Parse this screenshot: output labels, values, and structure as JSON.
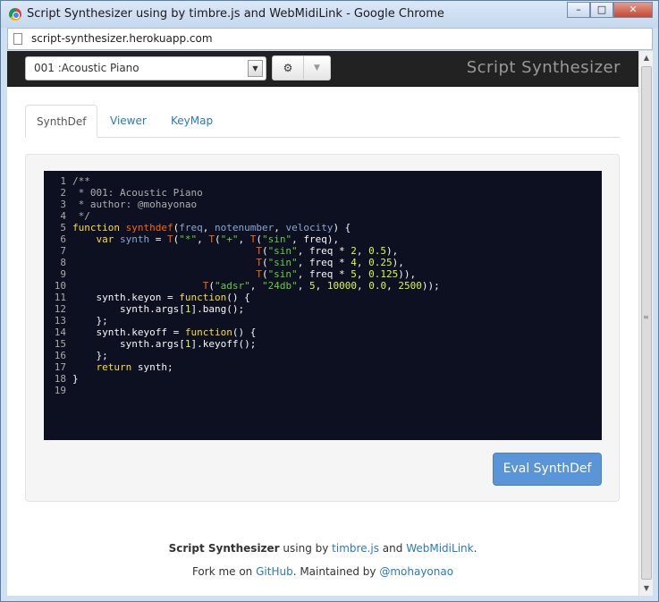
{
  "window": {
    "title": "Script Synthesizer using by timbre.js and WebMidiLink - Google Chrome",
    "url": "script-synthesizer.herokuapp.com"
  },
  "navbar": {
    "preset_value": "001 :Acoustic Piano",
    "brand": "Script Synthesizer"
  },
  "tabs": [
    "SynthDef",
    "Viewer",
    "KeyMap"
  ],
  "editor": {
    "line_numbers": [
      "1",
      "2",
      "3",
      "4",
      "5",
      "6",
      "7",
      "8",
      "9",
      "10",
      "11",
      "12",
      "13",
      "14",
      "15",
      "16",
      "17",
      "18",
      "19"
    ],
    "lines": [
      [
        [
          "cm",
          "/**"
        ]
      ],
      [
        [
          "cm",
          " * 001: Acoustic Piano"
        ]
      ],
      [
        [
          "cm",
          " * author: @mohayonao"
        ]
      ],
      [
        [
          "cm",
          " */"
        ]
      ],
      [
        [
          "kw",
          "function "
        ],
        [
          "fn",
          "synthdef"
        ],
        [
          "pl",
          "("
        ],
        [
          "var",
          "freq"
        ],
        [
          "pl",
          ", "
        ],
        [
          "var",
          "notenumber"
        ],
        [
          "pl",
          ", "
        ],
        [
          "var",
          "velocity"
        ],
        [
          "pl",
          ") {"
        ]
      ],
      [
        [
          "pl",
          "    "
        ],
        [
          "kw",
          "var "
        ],
        [
          "var",
          "synth"
        ],
        [
          "pl",
          " = "
        ],
        [
          "fn",
          "T"
        ],
        [
          "pl",
          "("
        ],
        [
          "str",
          "\"*\""
        ],
        [
          "pl",
          ", "
        ],
        [
          "fn",
          "T"
        ],
        [
          "pl",
          "("
        ],
        [
          "str",
          "\"+\""
        ],
        [
          "pl",
          ", "
        ],
        [
          "fn",
          "T"
        ],
        [
          "pl",
          "("
        ],
        [
          "str",
          "\"sin\""
        ],
        [
          "pl",
          ", freq),"
        ]
      ],
      [
        [
          "pl",
          "                               "
        ],
        [
          "fn",
          "T"
        ],
        [
          "pl",
          "("
        ],
        [
          "str",
          "\"sin\""
        ],
        [
          "pl",
          ", freq * "
        ],
        [
          "num",
          "2"
        ],
        [
          "pl",
          ", "
        ],
        [
          "num",
          "0.5"
        ],
        [
          "pl",
          "),"
        ]
      ],
      [
        [
          "pl",
          "                               "
        ],
        [
          "fn",
          "T"
        ],
        [
          "pl",
          "("
        ],
        [
          "str",
          "\"sin\""
        ],
        [
          "pl",
          ", freq * "
        ],
        [
          "num",
          "4"
        ],
        [
          "pl",
          ", "
        ],
        [
          "num",
          "0.25"
        ],
        [
          "pl",
          "),"
        ]
      ],
      [
        [
          "pl",
          "                               "
        ],
        [
          "fn",
          "T"
        ],
        [
          "pl",
          "("
        ],
        [
          "str",
          "\"sin\""
        ],
        [
          "pl",
          ", freq * "
        ],
        [
          "num",
          "5"
        ],
        [
          "pl",
          ", "
        ],
        [
          "num",
          "0.125"
        ],
        [
          "pl",
          ")),"
        ]
      ],
      [
        [
          "pl",
          "                      "
        ],
        [
          "fn",
          "T"
        ],
        [
          "pl",
          "("
        ],
        [
          "str",
          "\"adsr\""
        ],
        [
          "pl",
          ", "
        ],
        [
          "str",
          "\"24db\""
        ],
        [
          "pl",
          ", "
        ],
        [
          "num",
          "5"
        ],
        [
          "pl",
          ", "
        ],
        [
          "num",
          "10000"
        ],
        [
          "pl",
          ", "
        ],
        [
          "num",
          "0.0"
        ],
        [
          "pl",
          ", "
        ],
        [
          "num",
          "2500"
        ],
        [
          "pl",
          "));"
        ]
      ],
      [
        [
          "pl",
          "    synth.keyon = "
        ],
        [
          "kw",
          "function"
        ],
        [
          "pl",
          "() {"
        ]
      ],
      [
        [
          "pl",
          "        synth.args["
        ],
        [
          "num",
          "1"
        ],
        [
          "pl",
          "].bang();"
        ]
      ],
      [
        [
          "pl",
          "    };"
        ]
      ],
      [
        [
          "pl",
          "    synth.keyoff = "
        ],
        [
          "kw",
          "function"
        ],
        [
          "pl",
          "() {"
        ]
      ],
      [
        [
          "pl",
          "        synth.args["
        ],
        [
          "num",
          "1"
        ],
        [
          "pl",
          "].keyoff();"
        ]
      ],
      [
        [
          "pl",
          "    };"
        ]
      ],
      [
        [
          "pl",
          "    "
        ],
        [
          "kw",
          "return"
        ],
        [
          "pl",
          " synth;"
        ]
      ],
      [
        [
          "pl",
          "}"
        ]
      ],
      [
        [
          "pl",
          ""
        ]
      ]
    ]
  },
  "eval_button": "Eval SynthDef",
  "footer": {
    "line1_title": "Script Synthesizer",
    "line1_mid": " using by ",
    "link_timbre": "timbre.js",
    "line1_and": " and ",
    "link_webmidilink": "WebMidiLink",
    "line1_end": ".",
    "line2_pre": "Fork me on ",
    "link_github": "GitHub",
    "line2_mid": ". Maintained by ",
    "link_author": "@mohayonao"
  }
}
